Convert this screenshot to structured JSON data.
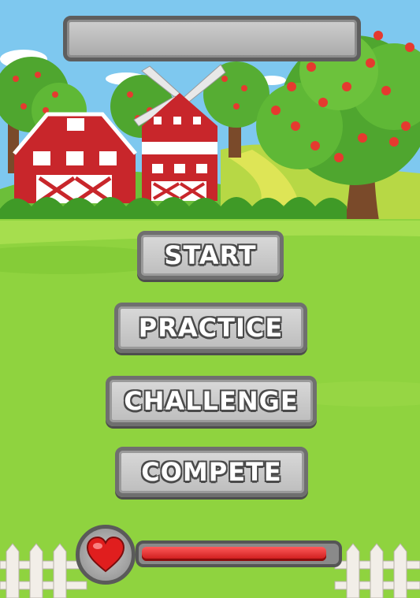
{
  "menu": {
    "start_label": "START",
    "practice_label": "PRACTICE",
    "challenge_label": "CHALLENGE",
    "compete_label": "COMPETE"
  },
  "title_plate_text": "",
  "health": {
    "level": 0.95
  },
  "colors": {
    "sky": "#7ec8ef",
    "grass": "#8fd33f",
    "barn_red": "#c8262b",
    "stone": "#bdbdbd",
    "stone_border": "#5e5e5e",
    "health_red": "#e01e1e"
  },
  "icons": {
    "heart": "heart-icon"
  }
}
